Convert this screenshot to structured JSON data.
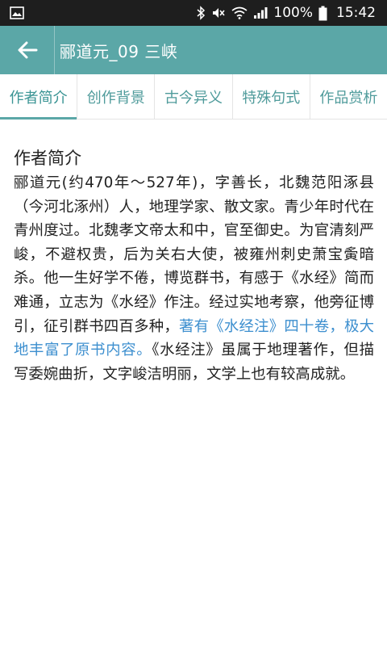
{
  "status_bar": {
    "battery": "100%",
    "time": "15:42",
    "icons": [
      "image-icon",
      "bluetooth-icon",
      "mute-icon",
      "wifi-icon",
      "signal-icon",
      "battery-icon"
    ]
  },
  "app_bar": {
    "title": "郦道元_09 三峡"
  },
  "tabs": [
    {
      "label": "作者简介",
      "active": true
    },
    {
      "label": "创作背景",
      "active": false
    },
    {
      "label": "古今异义",
      "active": false
    },
    {
      "label": "特殊句式",
      "active": false
    },
    {
      "label": "作品赏析",
      "active": false
    }
  ],
  "content": {
    "section_title": "作者简介",
    "text_before": "郦道元(约470年～527年)，字善长，北魏范阳涿县（今河北涿州）人，地理学家、散文家。青少年时代在青州度过。北魏孝文帝太和中，官至御史。为官清刻严峻，不避权贵，后为关右大使，被雍州刺史萧宝夤暗杀。他一生好学不倦，博览群书，有感于《水经》简而难通，立志为《水经》作注。经过实地考察，他旁征博引，征引群书四百多种，",
    "text_highlight": "著有《水经注》四十卷，极大地丰富了原书内容。",
    "text_after": "《水经注》虽属于地理著作，但描写委婉曲折，文字峻洁明丽，文学上也有较高成就。"
  },
  "colors": {
    "accent": "#5ba7a7",
    "highlight": "#3d8fcf",
    "status_bar": "#1e1e1e"
  }
}
